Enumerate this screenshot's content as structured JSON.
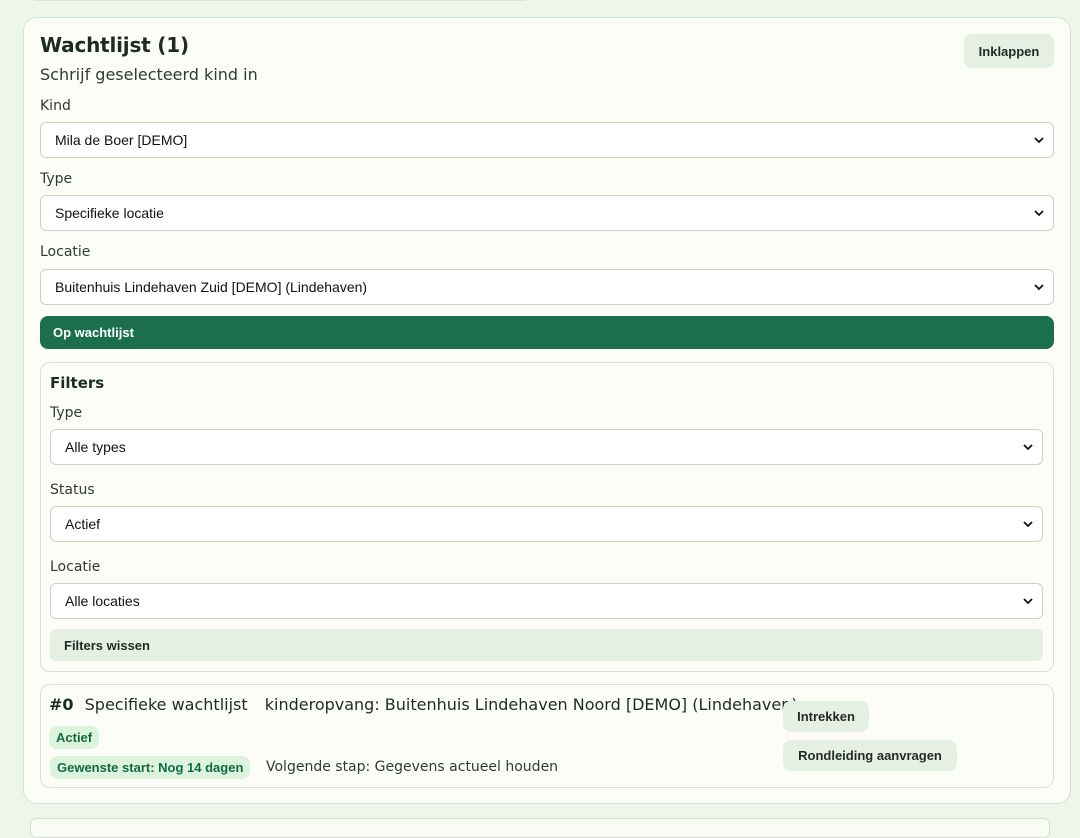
{
  "waitlist": {
    "title": "Wachtlijst (1)",
    "subtitle": "Schrijf geselecteerd kind in",
    "collapse_label": "Inklappen",
    "form": {
      "child_label": "Kind",
      "child_value": "Mila de Boer [DEMO]",
      "type_label": "Type",
      "type_value": "Specifieke locatie",
      "location_label": "Locatie",
      "location_value": "Buitenhuis Lindehaven Zuid [DEMO] (Lindehaven)",
      "submit_label": "Op wachtlijst"
    },
    "filters": {
      "title": "Filters",
      "type_label": "Type",
      "type_value": "Alle types",
      "status_label": "Status",
      "status_value": "Actief",
      "location_label": "Locatie",
      "location_value": "Alle locaties",
      "clear_label": "Filters wissen"
    },
    "entries": [
      {
        "number": "#0",
        "kind": "Specifieke wachtlijst",
        "detail": "kinderopvang: Buitenhuis Lindehaven Noord [DEMO] (Lindehaven)",
        "status": "Actief",
        "desired_start": "Gewenste start: Nog 14 dagen",
        "next_step": "Volgende stap: Gegevens actueel houden",
        "withdraw_label": "Intrekken",
        "tour_label": "Rondleiding aanvragen"
      }
    ]
  },
  "colors": {
    "primary": "#1b6f4f",
    "soft_button": "#e6f0e2",
    "badge_bg": "#dcf3dd",
    "badge_text": "#136a42",
    "page_bg": "#eef6ea"
  }
}
